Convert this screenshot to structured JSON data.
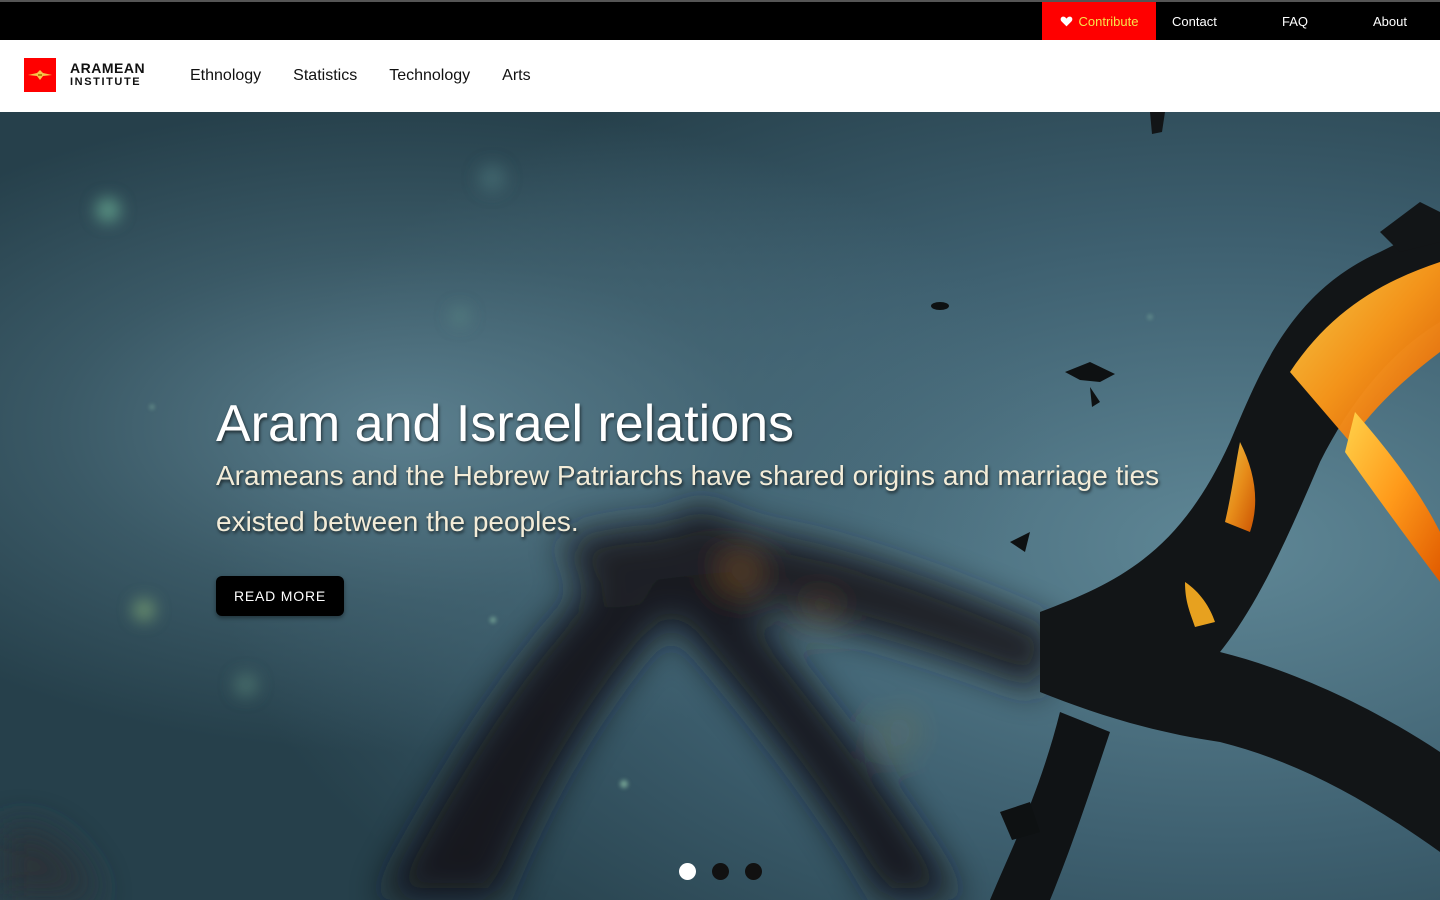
{
  "topbar": {
    "contribute_label": "Contribute",
    "contribute_icon": "heart-icon",
    "links": [
      "Contact",
      "FAQ",
      "About"
    ]
  },
  "header": {
    "logo_line1": "ARAMEAN",
    "logo_line2": "INSTITUTE",
    "nav": [
      "Ethnology",
      "Statistics",
      "Technology",
      "Arts"
    ]
  },
  "hero": {
    "title": "Aram and Israel relations",
    "subtitle": "Arameans and the Hebrew Patriarchs have shared origins and marriage ties existed between the peoples.",
    "button_label": "READ MORE",
    "slide_count": 3,
    "active_slide": 1
  },
  "colors": {
    "brand_red": "#ff0000",
    "contribute_text": "#f7e24a",
    "topbar_bg": "#000000"
  }
}
